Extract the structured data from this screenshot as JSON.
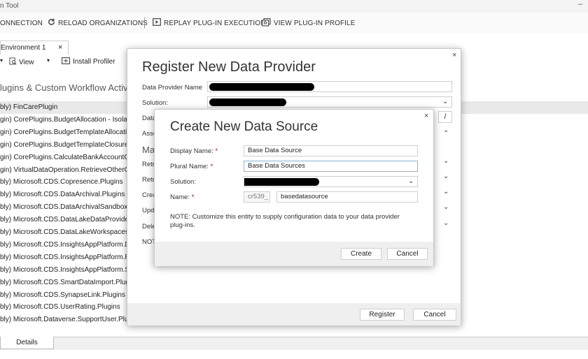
{
  "window": {
    "title": "n Tool",
    "minimize": "–"
  },
  "toolbar": {
    "connection": "ONNECTION",
    "reload": "RELOAD ORGANIZATIONS",
    "replay": "REPLAY PLUG-IN EXECUTION",
    "view_profile": "VIEW PLUG-IN PROFILE"
  },
  "tabs": {
    "env_label": "Environment 1",
    "close": "×"
  },
  "subtoolbar": {
    "view": "View",
    "install_profiler": "Install Profiler"
  },
  "plugins": {
    "heading": "lugins & Custom Workflow Activiti",
    "rows": [
      "bly) FinCarePlugin",
      "gin) CorePlugins.BudgetAllocation - Isolatc",
      "gin) CorePlugins.BudgetTemplateAllocatio",
      "gin) CorePlugins.BudgetTemplateClosure -",
      "gin) CorePlugins.CalculateBankAccountGai",
      "gin) VirtualDataOperation.RetrieveOtherOr",
      "bly) Microsoft.CDS.Copresence.Plugins",
      "bly) Microsoft.CDS.DataArchival.Plugins",
      "bly) Microsoft.CDS.DataArchivalSandbox.P",
      "bly) Microsoft.CDS.DataLakeDataProvider.I",
      "bly) Microsoft.CDS.DataLakeWorkspaces.Sa",
      "bly) Microsoft.CDS.InsightsAppPlatform.Df",
      "bly) Microsoft.CDS.InsightsAppPlatform.Plu",
      "bly) Microsoft.CDS.InsightsAppPlatform.Sb",
      "bly) Microsoft.CDS.SmartDataImport.Plugin",
      "bly) Microsoft.CDS.SynapseLink.Plugins",
      "bly) Microsoft.CDS.UserRating.Plugins",
      "bly) Microsoft.Dataverse.SupportUser.Plug"
    ]
  },
  "bottom": {
    "details_tab": "Details"
  },
  "register_dialog": {
    "title": "Register New Data Provider",
    "close": "×",
    "data_provider_name_label": "Data Provider Name",
    "solution_label": "Solution:",
    "data_label_partial": "Data",
    "assembly_label_partial": "Asse",
    "ma_label_partial": "Ma",
    "retrieve1_partial": "Retr",
    "retrieve2_partial": "Retr",
    "create_partial": "Crea",
    "update_partial": "Upd",
    "delete_partial": "Dele",
    "note_partial": "NOT",
    "slash_button": "/",
    "register_button": "Register",
    "cancel_button": "Cancel"
  },
  "datasource_dialog": {
    "title": "Create New Data Source",
    "close": "×",
    "display_name_label": "Display Name:",
    "display_name_value": "Base Data Source",
    "plural_name_label": "Plural Name:",
    "plural_name_value": "Base Data Sources",
    "solution_label": "Solution:",
    "name_label": "Name:",
    "prefix_value": "cr539_",
    "name_value": "basedatasource",
    "required_marker": "*",
    "note": "NOTE: Customize this entity to supply configuration data to your data provider plug-ins.",
    "create_button": "Create",
    "cancel_button": "Cancel"
  }
}
